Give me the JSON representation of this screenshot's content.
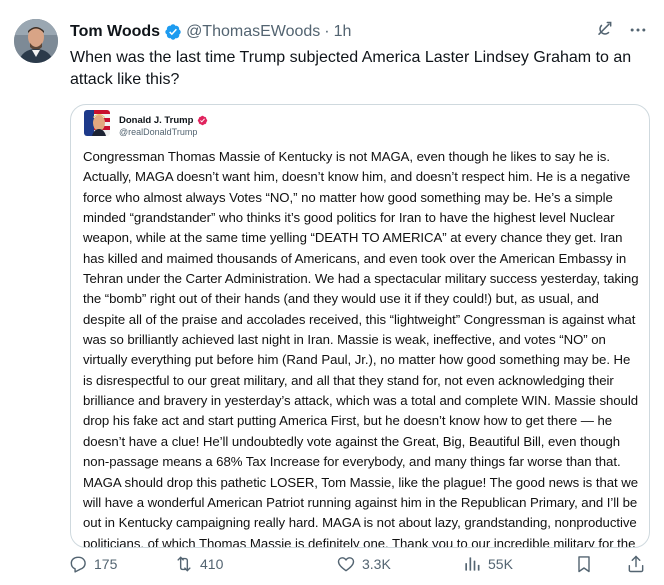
{
  "author": {
    "display_name": "Tom Woods",
    "handle": "@ThomasEWoods",
    "separator": "·",
    "time": "1h",
    "verified_icon": "verified-badge-icon"
  },
  "tweet": {
    "text": "When was the last time Trump subjected America Laster Lindsey Graham to an attack like this?"
  },
  "quote": {
    "display_name": "Donald J. Trump",
    "handle": "@realDonaldTrump",
    "body": "Congressman Thomas Massie of Kentucky is not MAGA, even though he likes to say he is. Actually, MAGA doesn’t want him, doesn’t know him, and doesn’t respect him. He is a negative force who almost always Votes “NO,” no matter how good something may be. He’s a simple minded “grandstander” who thinks it’s good politics for Iran to have the highest level Nuclear weapon, while at the same time yelling “DEATH TO AMERICA” at every chance they get. Iran has killed and maimed thousands of Americans, and even took over the American Embassy in Tehran under the Carter Administration. We had a spectacular military success yesterday, taking the “bomb” right out of their hands (and they would use it if they could!) but, as usual, and despite all of the praise and accolades received, this “lightweight” Congressman is against what was so brilliantly achieved last night in Iran. Massie is weak, ineffective, and votes “NO” on virtually everything put before him (Rand Paul, Jr.), no matter how good something may be. He is disrespectful to our great military, and all that they stand for, not even acknowledging their brilliance and bravery in yesterday’s attack, which was a total and complete WIN. Massie should drop his fake act and start putting America First, but he doesn’t know how to get there — he doesn’t have a clue! He’ll undoubtedly vote against the Great, Big, Beautiful Bill, even though non-passage means a 68% Tax Increase for everybody, and many things far worse than that. MAGA should drop this pathetic LOSER, Tom Massie, like the plague! The good news is that we will have a wonderful American Patriot running against him in the Republican Primary, and I’ll be out in Kentucky campaigning really hard. MAGA is not about lazy, grandstanding, nonproductive politicians, of which Thomas Massie is definitely one. Thank you to our incredible military for the AMAZING job they did last night. It was really SPECIAL!!! MAKE AMERICA GREAT AGAIN."
  },
  "actions": {
    "replies": "175",
    "reposts": "410",
    "likes": "3.3K",
    "views": "55K"
  },
  "colors": {
    "verified_blue": "#1d9bf0",
    "secondary_text": "#536471",
    "border": "#cfd9de",
    "quote_verified_red": "#e0245e"
  },
  "icons": {
    "header": [
      "grok-icon",
      "more-icon"
    ],
    "actions": [
      "reply-icon",
      "repost-icon",
      "like-icon",
      "views-icon",
      "bookmark-icon",
      "share-icon"
    ]
  }
}
